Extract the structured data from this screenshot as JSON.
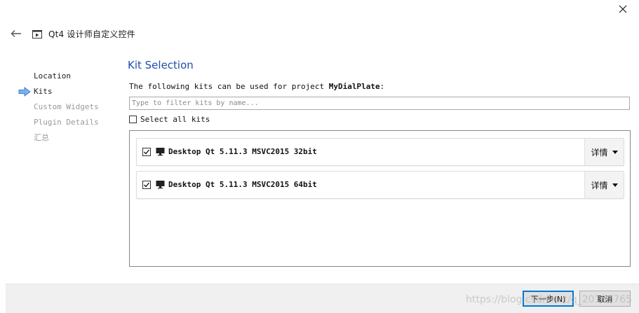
{
  "window": {
    "title": "Qt4 设计师自定义控件"
  },
  "steps": [
    {
      "label": "Location",
      "state": "done"
    },
    {
      "label": "Kits",
      "state": "current"
    },
    {
      "label": "Custom Widgets",
      "state": "pending"
    },
    {
      "label": "Plugin Details",
      "state": "pending"
    },
    {
      "label": "汇总",
      "state": "pending"
    }
  ],
  "page": {
    "title": "Kit Selection",
    "intro_prefix": "The following kits can be used for project ",
    "project_name": "MyDialPlate",
    "intro_suffix": ":"
  },
  "filter": {
    "value": "",
    "placeholder": "Type to filter kits by name..."
  },
  "select_all": {
    "label": "Select all kits",
    "checked": false
  },
  "kits": [
    {
      "name": "Desktop Qt 5.11.3 MSVC2015 32bit",
      "checked": true,
      "details_label": "详情",
      "icon": "monitor-icon"
    },
    {
      "name": "Desktop Qt 5.11.3 MSVC2015 64bit",
      "checked": true,
      "details_label": "详情",
      "icon": "monitor-icon"
    }
  ],
  "footer": {
    "next_label": "下一步(N)",
    "cancel_label": "取消",
    "watermark": "https://blog.csdn.net/q_20151765"
  },
  "colors": {
    "accent_title": "#1e4ea8",
    "step_arrow": "#3c7fd6",
    "primary_border": "#0078d7"
  }
}
